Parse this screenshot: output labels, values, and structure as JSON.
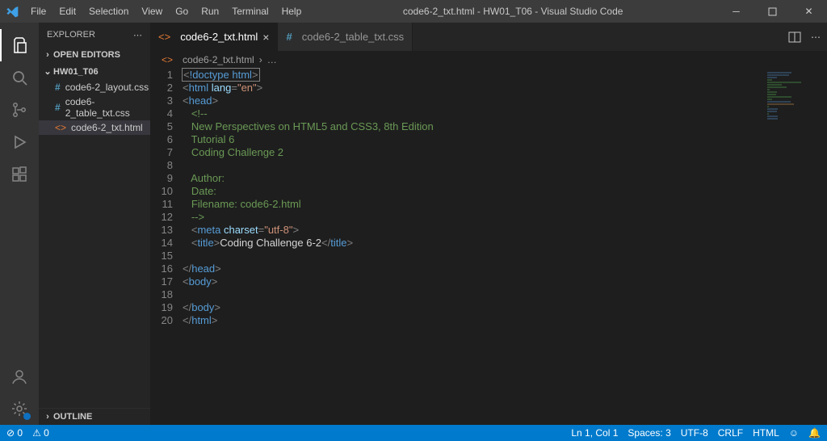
{
  "title_bar": {
    "menus": [
      "File",
      "Edit",
      "Selection",
      "View",
      "Go",
      "Run",
      "Terminal",
      "Help"
    ],
    "title": "code6-2_txt.html - HW01_T06 - Visual Studio Code"
  },
  "sidebar": {
    "header": "EXPLORER",
    "open_editors": "OPEN EDITORS",
    "project": "HW01_T06",
    "files": [
      {
        "name": "code6-2_layout.css",
        "icon": "css"
      },
      {
        "name": "code6-2_table_txt.css",
        "icon": "css"
      },
      {
        "name": "code6-2_txt.html",
        "icon": "html",
        "selected": true
      }
    ],
    "outline": "OUTLINE"
  },
  "tabs": [
    {
      "label": "code6-2_txt.html",
      "icon": "html",
      "active": true
    },
    {
      "label": "code6-2_table_txt.css",
      "icon": "css",
      "active": false
    }
  ],
  "breadcrumb": {
    "file": "code6-2_txt.html",
    "rest": "…"
  },
  "code": {
    "lines": [
      {
        "n": 1,
        "indent": 0,
        "wrap": true,
        "parts": [
          [
            "angle",
            "<"
          ],
          [
            "doctype",
            "!doctype"
          ],
          [
            "text",
            " "
          ],
          [
            "doctype",
            "html"
          ],
          [
            "angle",
            ">"
          ]
        ]
      },
      {
        "n": 2,
        "indent": 0,
        "parts": [
          [
            "angle",
            "<"
          ],
          [
            "tag",
            "html"
          ],
          [
            "text",
            " "
          ],
          [
            "attr",
            "lang"
          ],
          [
            "angle",
            "="
          ],
          [
            "str",
            "\"en\""
          ],
          [
            "angle",
            ">"
          ]
        ]
      },
      {
        "n": 3,
        "indent": 0,
        "parts": [
          [
            "angle",
            "<"
          ],
          [
            "tag",
            "head"
          ],
          [
            "angle",
            ">"
          ]
        ]
      },
      {
        "n": 4,
        "indent": 1,
        "parts": [
          [
            "comment",
            "<!--"
          ]
        ]
      },
      {
        "n": 5,
        "indent": 1,
        "parts": [
          [
            "comment",
            "New Perspectives on HTML5 and CSS3, 8th Edition"
          ]
        ]
      },
      {
        "n": 6,
        "indent": 1,
        "parts": [
          [
            "comment",
            "Tutorial 6"
          ]
        ]
      },
      {
        "n": 7,
        "indent": 1,
        "parts": [
          [
            "comment",
            "Coding Challenge 2"
          ]
        ]
      },
      {
        "n": 8,
        "indent": 1,
        "parts": []
      },
      {
        "n": 9,
        "indent": 1,
        "parts": [
          [
            "comment",
            "Author:"
          ]
        ]
      },
      {
        "n": 10,
        "indent": 1,
        "parts": [
          [
            "comment",
            "Date:"
          ]
        ]
      },
      {
        "n": 11,
        "indent": 1,
        "parts": [
          [
            "comment",
            "Filename: code6-2.html"
          ]
        ]
      },
      {
        "n": 12,
        "indent": 1,
        "parts": [
          [
            "comment",
            "-->"
          ]
        ]
      },
      {
        "n": 13,
        "indent": 1,
        "parts": [
          [
            "angle",
            "<"
          ],
          [
            "tag",
            "meta"
          ],
          [
            "text",
            " "
          ],
          [
            "attr",
            "charset"
          ],
          [
            "angle",
            "="
          ],
          [
            "str",
            "\"utf-8\""
          ],
          [
            "angle",
            ">"
          ]
        ]
      },
      {
        "n": 14,
        "indent": 1,
        "parts": [
          [
            "angle",
            "<"
          ],
          [
            "tag",
            "title"
          ],
          [
            "angle",
            ">"
          ],
          [
            "text",
            "Coding Challenge 6-2"
          ],
          [
            "angle",
            "</"
          ],
          [
            "tag",
            "title"
          ],
          [
            "angle",
            ">"
          ]
        ]
      },
      {
        "n": 15,
        "indent": 0,
        "parts": []
      },
      {
        "n": 16,
        "indent": 0,
        "parts": [
          [
            "angle",
            "</"
          ],
          [
            "tag",
            "head"
          ],
          [
            "angle",
            ">"
          ]
        ]
      },
      {
        "n": 17,
        "indent": 0,
        "parts": [
          [
            "angle",
            "<"
          ],
          [
            "tag",
            "body"
          ],
          [
            "angle",
            ">"
          ]
        ]
      },
      {
        "n": 18,
        "indent": 0,
        "parts": []
      },
      {
        "n": 19,
        "indent": 0,
        "parts": [
          [
            "angle",
            "</"
          ],
          [
            "tag",
            "body"
          ],
          [
            "angle",
            ">"
          ]
        ]
      },
      {
        "n": 20,
        "indent": 0,
        "parts": [
          [
            "angle",
            "</"
          ],
          [
            "tag",
            "html"
          ],
          [
            "angle",
            ">"
          ]
        ]
      }
    ]
  },
  "status": {
    "left": [
      "⊘ 0",
      "⚠ 0"
    ],
    "right": [
      "Ln 1, Col 1",
      "Spaces: 3",
      "UTF-8",
      "CRLF",
      "HTML"
    ]
  }
}
